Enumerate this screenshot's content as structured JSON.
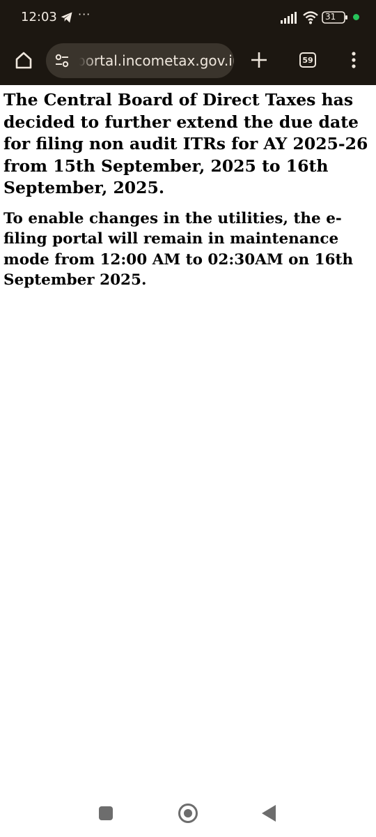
{
  "status_bar": {
    "time": "12:03",
    "notification_icons": [
      "telegram-icon",
      "more-dots"
    ],
    "more_indicator": "···",
    "battery_level": "31",
    "system_icons": [
      "signal-icon",
      "wifi-icon",
      "battery-icon"
    ],
    "privacy_dot_color": "#27c35a"
  },
  "toolbar": {
    "url": "portal.incometax.gov.in",
    "tab_count": "59",
    "background_color": "#1c1711"
  },
  "content": {
    "paragraphs": [
      "The Central Board of Direct Taxes has decided to further extend the due date for filing non audit ITRs for AY 2025-26 from 15th September, 2025 to 16th September, 2025.",
      "To enable changes in the utilities, the e-filing portal will remain in maintenance mode from 12:00 AM to 02:30AM on 16th September 2025."
    ]
  },
  "nav_bar": {
    "buttons": [
      "recent-apps",
      "home",
      "back"
    ]
  }
}
